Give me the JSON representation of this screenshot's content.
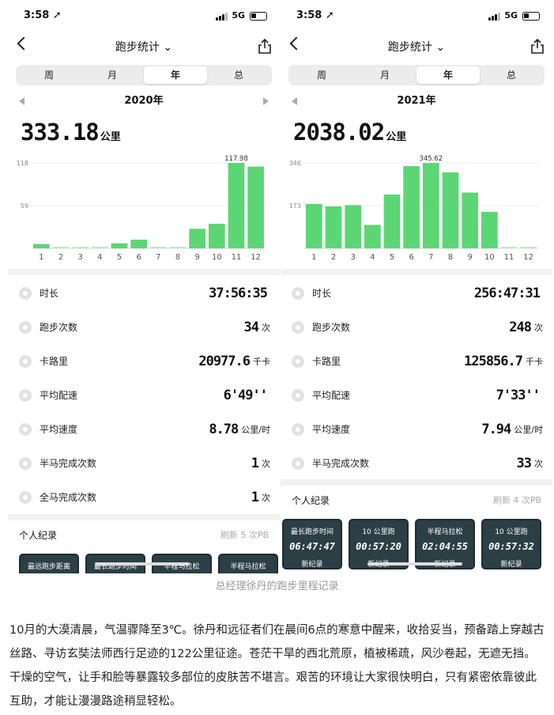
{
  "caption": "总经理徐丹的跑步里程记录",
  "paragraph": "10月的大漠清晨，气温骤降至3℃。徐丹和远征者们在晨间6点的寒意中醒来，收拾妥当，预备踏上穿越古丝路、寻访玄奘法师西行足迹的122公里征途。苍茫干旱的西北荒原，植被稀疏，风沙卷起，无遮无挡。干燥的空气，让手和脸等暴露较多部位的皮肤苦不堪言。艰苦的环境让大家很快明白，只有紧密依靠彼此互助，才能让漫漫路途稍显轻松。",
  "colors": {
    "bar": "#5cd675",
    "bar_low": "#b8ecc4",
    "card": "#2c3e46"
  },
  "panels": [
    {
      "status": {
        "time": "3:58 ➚",
        "network": "5G"
      },
      "nav": {
        "title": "跑步统计 ⌄"
      },
      "segments": [
        "周",
        "月",
        "年",
        "总"
      ],
      "active_segment": 2,
      "year": "2020年",
      "total": {
        "value": "333.18",
        "unit": "公里"
      },
      "stats": [
        {
          "icon": "clock-icon",
          "label": "时长",
          "value": "37:56:35",
          "unit": ""
        },
        {
          "icon": "run-count-icon",
          "label": "跑步次数",
          "value": "34",
          "unit": "次"
        },
        {
          "icon": "flame-icon",
          "label": "卡路里",
          "value": "20977.6",
          "unit": "千卡"
        },
        {
          "icon": "pace-icon",
          "label": "平均配速",
          "value": "6'49''",
          "unit": ""
        },
        {
          "icon": "speed-icon",
          "label": "平均速度",
          "value": "8.78",
          "unit": "公里/时"
        },
        {
          "icon": "half-marathon-icon",
          "label": "半马完成次数",
          "value": "1",
          "unit": "次"
        },
        {
          "icon": "full-marathon-icon",
          "label": "全马完成次数",
          "value": "1",
          "unit": "次"
        }
      ],
      "pb": {
        "title": "个人纪录",
        "sub": "刷新 5 次PB"
      },
      "cards": [
        {
          "title": "最远跑步距离",
          "value": "",
          "badge": ""
        },
        {
          "title": "最长跑步时间",
          "value": "",
          "badge": ""
        },
        {
          "title": "半程马拉松",
          "value": "",
          "badge": ""
        },
        {
          "title": "半程马拉松",
          "value": "",
          "badge": ""
        }
      ],
      "chart_data": {
        "type": "bar",
        "categories": [
          "1",
          "2",
          "3",
          "4",
          "5",
          "6",
          "7",
          "8",
          "9",
          "10",
          "11",
          "12"
        ],
        "values": [
          6,
          1,
          1,
          1,
          7,
          12,
          1,
          1,
          27,
          34,
          117.98,
          113
        ],
        "ylim": [
          0,
          118
        ],
        "yticks": [
          "118",
          "59"
        ],
        "peak_label": "117.98",
        "title": "",
        "xlabel": "",
        "ylabel": ""
      }
    },
    {
      "status": {
        "time": "3:58 ➚",
        "network": "5G"
      },
      "nav": {
        "title": "跑步统计 ⌄"
      },
      "segments": [
        "周",
        "月",
        "年",
        "总"
      ],
      "active_segment": 2,
      "year": "2021年",
      "total": {
        "value": "2038.02",
        "unit": "公里"
      },
      "stats": [
        {
          "icon": "clock-icon",
          "label": "时长",
          "value": "256:47:31",
          "unit": ""
        },
        {
          "icon": "run-count-icon",
          "label": "跑步次数",
          "value": "248",
          "unit": "次"
        },
        {
          "icon": "flame-icon",
          "label": "卡路里",
          "value": "125856.7",
          "unit": "千卡"
        },
        {
          "icon": "pace-icon",
          "label": "平均配速",
          "value": "7'33''",
          "unit": ""
        },
        {
          "icon": "speed-icon",
          "label": "平均速度",
          "value": "7.94",
          "unit": "公里/时"
        },
        {
          "icon": "half-marathon-icon",
          "label": "半马完成次数",
          "value": "33",
          "unit": "次"
        }
      ],
      "pb": {
        "title": "个人纪录",
        "sub": "刷新 4 次PB"
      },
      "cards": [
        {
          "title": "最长跑步时间",
          "value": "06:47:47",
          "badge": "新纪录"
        },
        {
          "title": "10 公里跑",
          "value": "00:57:20",
          "badge": "新纪录"
        },
        {
          "title": "半程马拉松",
          "value": "02:04:55",
          "badge": "新纪录"
        },
        {
          "title": "10 公里跑",
          "value": "00:57:32",
          "badge": "新纪录"
        }
      ],
      "chart_data": {
        "type": "bar",
        "categories": [
          "1",
          "2",
          "3",
          "4",
          "5",
          "6",
          "7",
          "8",
          "9",
          "10",
          "11",
          "12"
        ],
        "values": [
          180,
          170,
          175,
          95,
          218,
          333,
          345.62,
          308,
          226,
          148,
          1,
          1
        ],
        "ylim": [
          0,
          346
        ],
        "yticks": [
          "346",
          "173"
        ],
        "peak_label": "345.62",
        "title": "",
        "xlabel": "",
        "ylabel": ""
      }
    }
  ]
}
